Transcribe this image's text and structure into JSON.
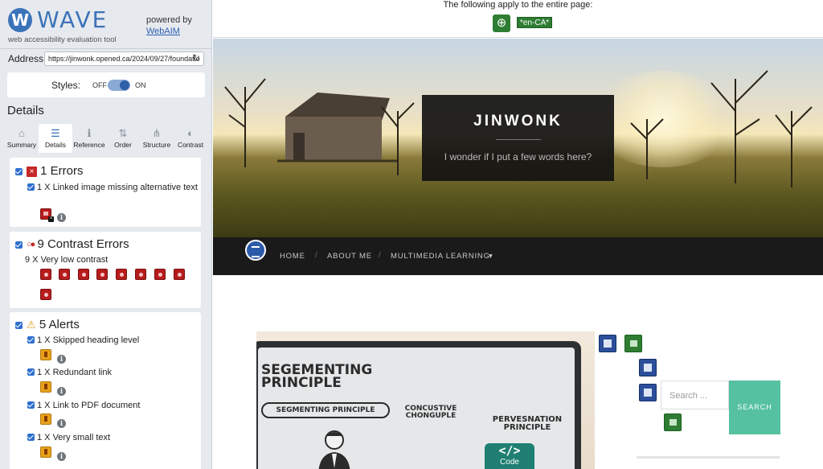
{
  "wave": {
    "logo_letter": "W",
    "logo_word": "WAVE",
    "tagline": "web accessibility evaluation tool",
    "powered_by": "powered by",
    "webaim_link": "WebAIM",
    "address_label": "Address:",
    "address_value": "https://jinwonk.opened.ca/2024/09/27/foundatio",
    "styles_label": "Styles:",
    "styles_off": "OFF",
    "styles_on": "ON",
    "details_title": "Details",
    "tabs": [
      {
        "label": "Summary",
        "icon": "home-icon"
      },
      {
        "label": "Details",
        "icon": "list-icon"
      },
      {
        "label": "Reference",
        "icon": "info-icon"
      },
      {
        "label": "Order",
        "icon": "order-icon"
      },
      {
        "label": "Structure",
        "icon": "structure-icon"
      },
      {
        "label": "Contrast",
        "icon": "contrast-icon"
      }
    ],
    "errors": {
      "heading": "1 Errors",
      "items": [
        "1 X Linked image missing alternative text"
      ]
    },
    "contrast": {
      "heading": "9 Contrast Errors",
      "items": [
        "9 X Very low contrast"
      ]
    },
    "alerts": {
      "heading": "5 Alerts",
      "items": [
        "1 X Skipped heading level",
        "1 X Redundant link",
        "1 X Link to PDF document",
        "1 X Very small text"
      ]
    },
    "colors": {
      "accent": "#3b73b9",
      "error": "#b71c1c",
      "alert": "#e8a21a",
      "feature": "#2e7d32"
    }
  },
  "page": {
    "notice": "The following apply to the entire page:",
    "lang_tag": "*en-CA*",
    "site_title": "JINWONK",
    "site_tagline": "I wonder if I put a few words here?",
    "nav": [
      "HOME",
      "ABOUT ME",
      "MULTIMEDIA LEARNING"
    ],
    "nav_dropdown_caret": "▾",
    "image_text": {
      "segmenting_big": "SEGEMENTING PRINCIPLE",
      "segmenting_small": "SEGMENTING PRINCIPLE",
      "concept": "CONCUSTIVE CHONGUPLE",
      "perv": "PERVESNATION PRINCIPLE"
    },
    "code_tag": "Code",
    "code_icon": "</>",
    "search_placeholder": "Search ...",
    "search_button": "SEARCH"
  }
}
